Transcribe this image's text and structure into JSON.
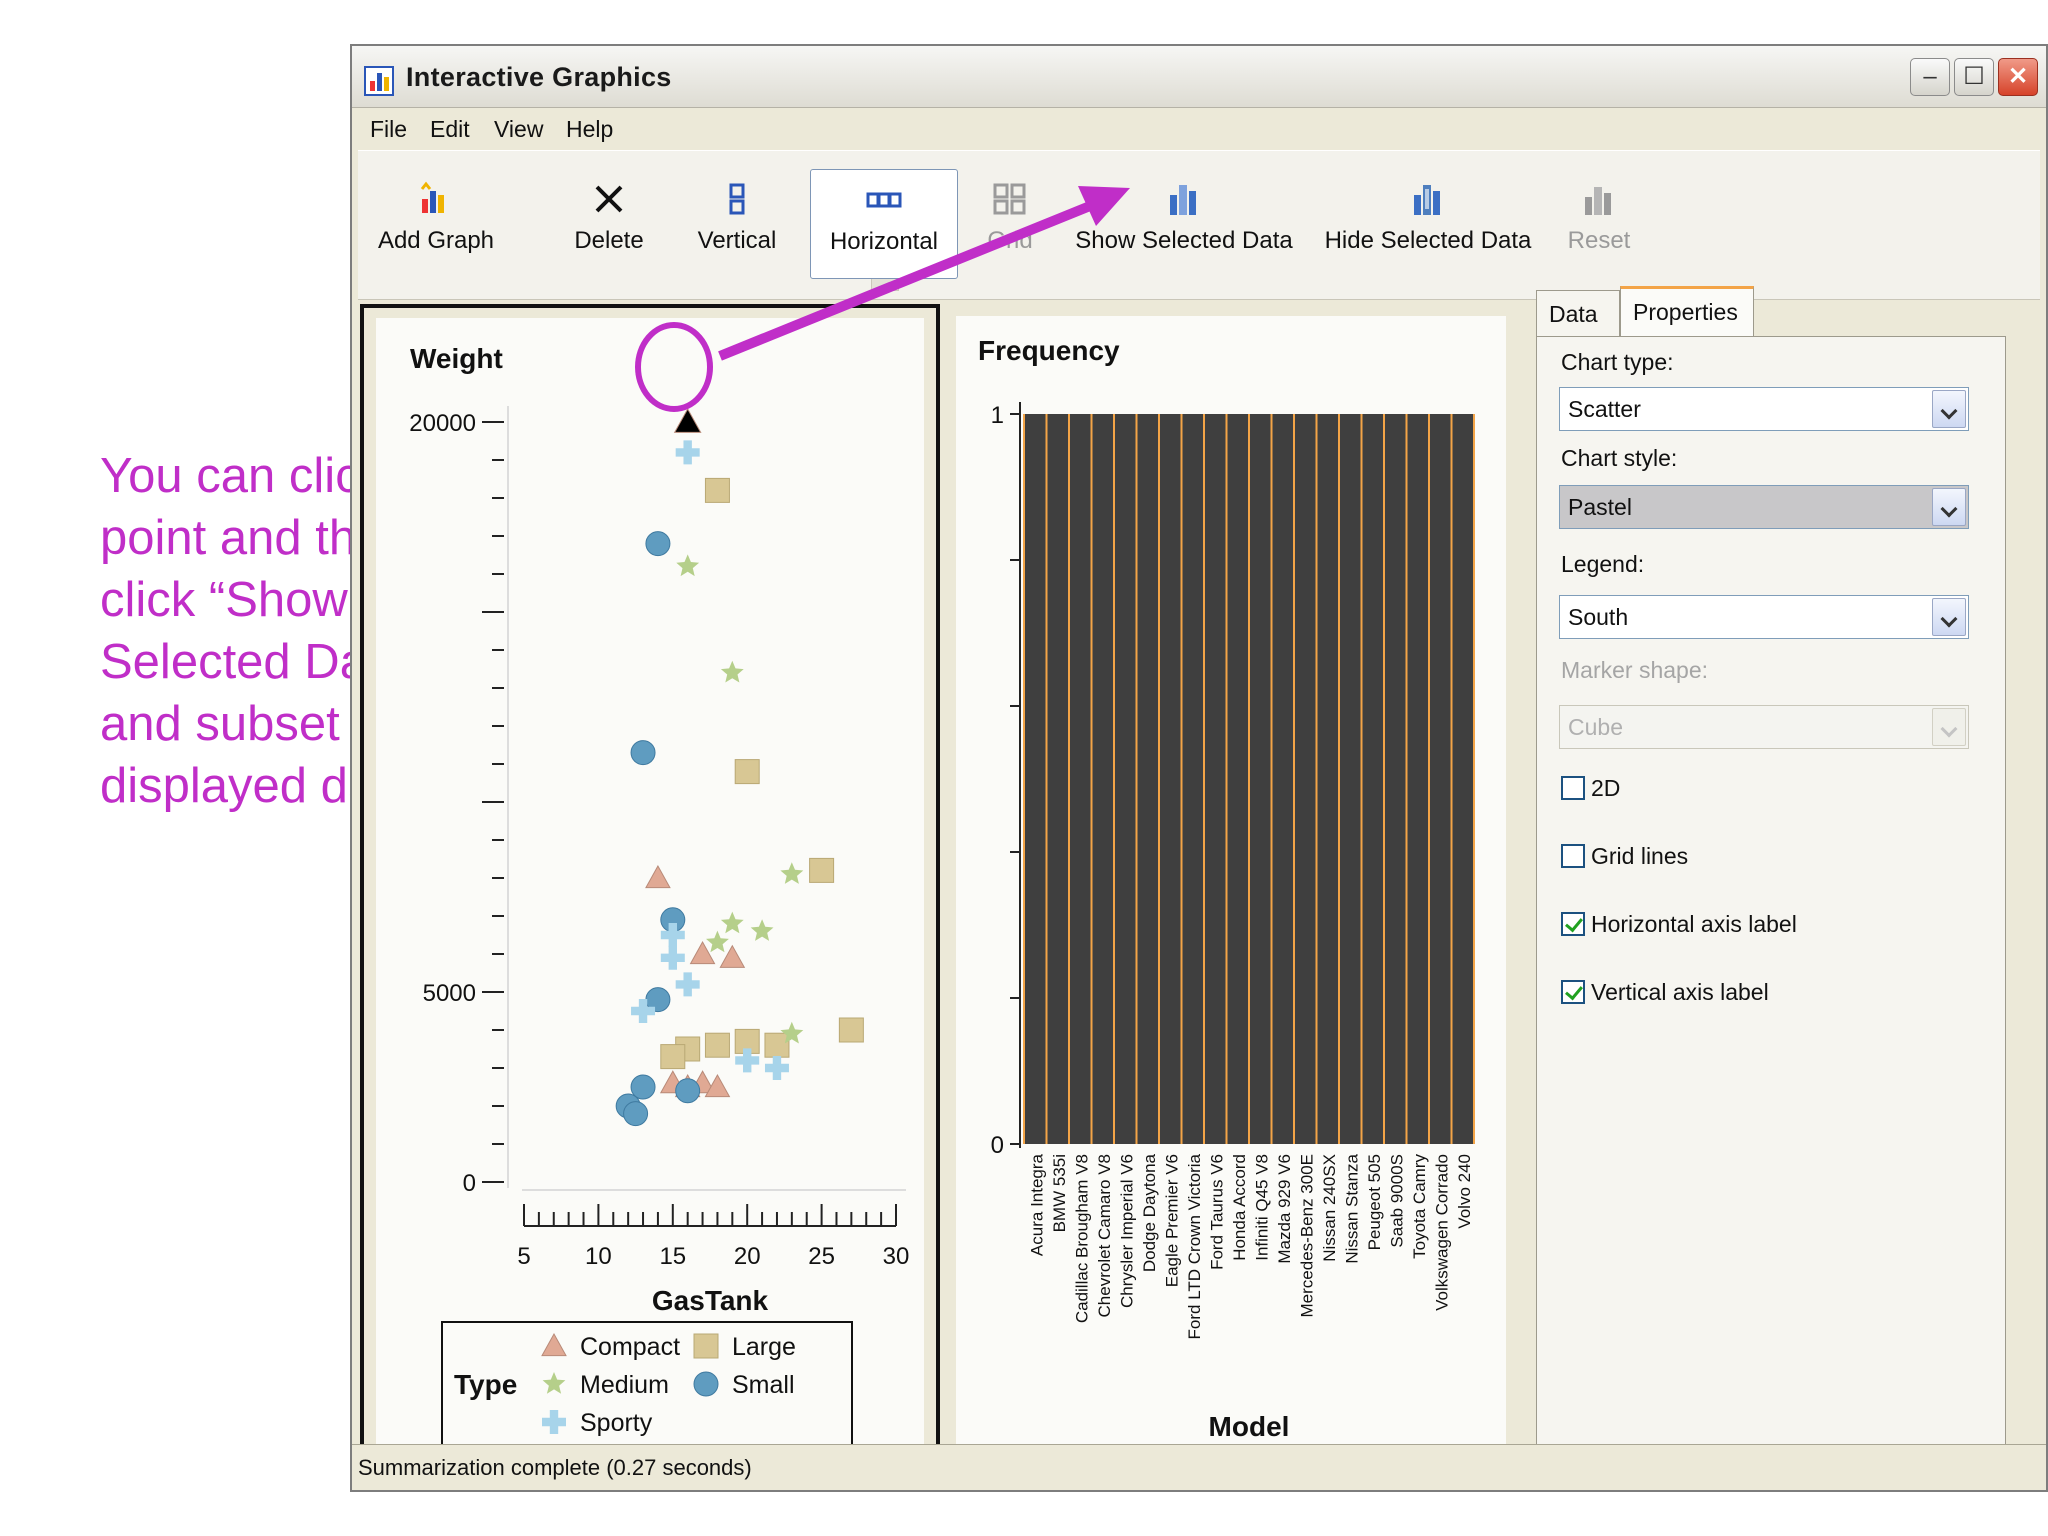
{
  "annotation": {
    "lines": [
      "You can click a",
      "point and then",
      "click “Show",
      "Selected Data”",
      "and subset the",
      "displayed data."
    ],
    "color": "#c02ec8"
  },
  "window": {
    "title": "Interactive Graphics",
    "controls": [
      "minimize-icon",
      "maximize-icon",
      "close-icon"
    ]
  },
  "menu": {
    "file": "File",
    "edit": "Edit",
    "view": "View",
    "help": "Help"
  },
  "toolbar": {
    "add_graph": "Add Graph",
    "delete": "Delete",
    "vertical": "Vertical",
    "horizontal": "Horizontal",
    "grid": "Grid",
    "show_selected": "Show Selected Data",
    "hide_selected": "Hide Selected Data",
    "reset": "Reset"
  },
  "tabs": {
    "data": "Data",
    "properties": "Properties"
  },
  "properties": {
    "chart_type_label": "Chart type:",
    "chart_type_value": "Scatter",
    "chart_style_label": "Chart style:",
    "chart_style_value": "Pastel",
    "legend_label": "Legend:",
    "legend_value": "South",
    "marker_shape_label": "Marker shape:",
    "marker_shape_value": "Cube",
    "two_d_label": "2D",
    "two_d_checked": false,
    "grid_lines_label": "Grid lines",
    "grid_lines_checked": false,
    "h_axis_label": "Horizontal axis label",
    "h_axis_checked": true,
    "v_axis_label": "Vertical axis label",
    "v_axis_checked": true
  },
  "status": "Summarization complete (0.27 seconds)",
  "chart_data": [
    {
      "type": "scatter",
      "title": "",
      "xlabel": "GasTank",
      "ylabel": "Weight",
      "xlim": [
        5,
        30
      ],
      "ylim": [
        0,
        20000
      ],
      "x_ticks": [
        "5",
        "10",
        "15",
        "20",
        "25",
        "30"
      ],
      "y_ticks": [
        "0",
        "5000",
        "20000"
      ],
      "legend": {
        "title": "Type",
        "placement": "bottom",
        "entries": [
          {
            "name": "Compact",
            "shape": "cone",
            "color": "#e0a994"
          },
          {
            "name": "Large",
            "shape": "cube",
            "color": "#d8c794"
          },
          {
            "name": "Medium",
            "shape": "star",
            "color": "#b5cf8a"
          },
          {
            "name": "Small",
            "shape": "sphere",
            "color": "#5f9cc0"
          },
          {
            "name": "Sporty",
            "shape": "cross",
            "color": "#a7d4ea"
          }
        ]
      },
      "selected_point": {
        "x": 16,
        "y": 20000
      },
      "series": [
        {
          "name": "Compact",
          "points": [
            [
              14,
              8000
            ],
            [
              17,
              6000
            ],
            [
              19,
              5900
            ],
            [
              15,
              2600
            ],
            [
              16,
              2500
            ],
            [
              17,
              2600
            ],
            [
              18,
              2500
            ]
          ]
        },
        {
          "name": "Large",
          "points": [
            [
              18,
              18200
            ],
            [
              20,
              10800
            ],
            [
              25,
              8200
            ],
            [
              27,
              4000
            ],
            [
              16,
              3500
            ],
            [
              18,
              3600
            ],
            [
              20,
              3700
            ],
            [
              22,
              3600
            ],
            [
              15,
              3300
            ]
          ]
        },
        {
          "name": "Medium",
          "points": [
            [
              16,
              16200
            ],
            [
              19,
              13400
            ],
            [
              23,
              8100
            ],
            [
              19,
              6800
            ],
            [
              21,
              6600
            ],
            [
              18,
              6300
            ],
            [
              23,
              3900
            ]
          ]
        },
        {
          "name": "Small",
          "points": [
            [
              14,
              16800
            ],
            [
              13,
              11300
            ],
            [
              15,
              6900
            ],
            [
              14,
              4800
            ],
            [
              12,
              2000
            ],
            [
              12.5,
              1800
            ],
            [
              13,
              2500
            ],
            [
              16,
              2400
            ]
          ]
        },
        {
          "name": "Sporty",
          "points": [
            [
              16,
              19200
            ],
            [
              15,
              6500
            ],
            [
              15,
              5900
            ],
            [
              16,
              5200
            ],
            [
              13,
              4500
            ],
            [
              20,
              3200
            ],
            [
              22,
              3000
            ]
          ]
        }
      ]
    },
    {
      "type": "bar",
      "title": "",
      "xlabel": "Model",
      "ylabel": "Frequency",
      "ylim": [
        0,
        1
      ],
      "y_ticks": [
        "0",
        "1"
      ],
      "categories": [
        "Acura Integra",
        "BMW 535i",
        "Cadillac Brougham V8",
        "Chevrolet Camaro V8",
        "Chrysler Imperial V6",
        "Dodge Daytona",
        "Eagle Premier V6",
        "Ford LTD Crown Victoria",
        "Ford Taurus V6",
        "Honda Accord",
        "Infiniti Q45 V8",
        "Mazda 929 V6",
        "Mercedes-Benz 300E",
        "Nissan 240SX",
        "Nissan Stanza",
        "Peugeot 505",
        "Saab 9000S",
        "Toyota Camry",
        "Volkswagen Corrado",
        "Volvo 240"
      ],
      "values": [
        1,
        1,
        1,
        1,
        1,
        1,
        1,
        1,
        1,
        1,
        1,
        1,
        1,
        1,
        1,
        1,
        1,
        1,
        1,
        1
      ],
      "bar_color": "#3f3f3f",
      "separator_color": "#f3a447"
    }
  ]
}
